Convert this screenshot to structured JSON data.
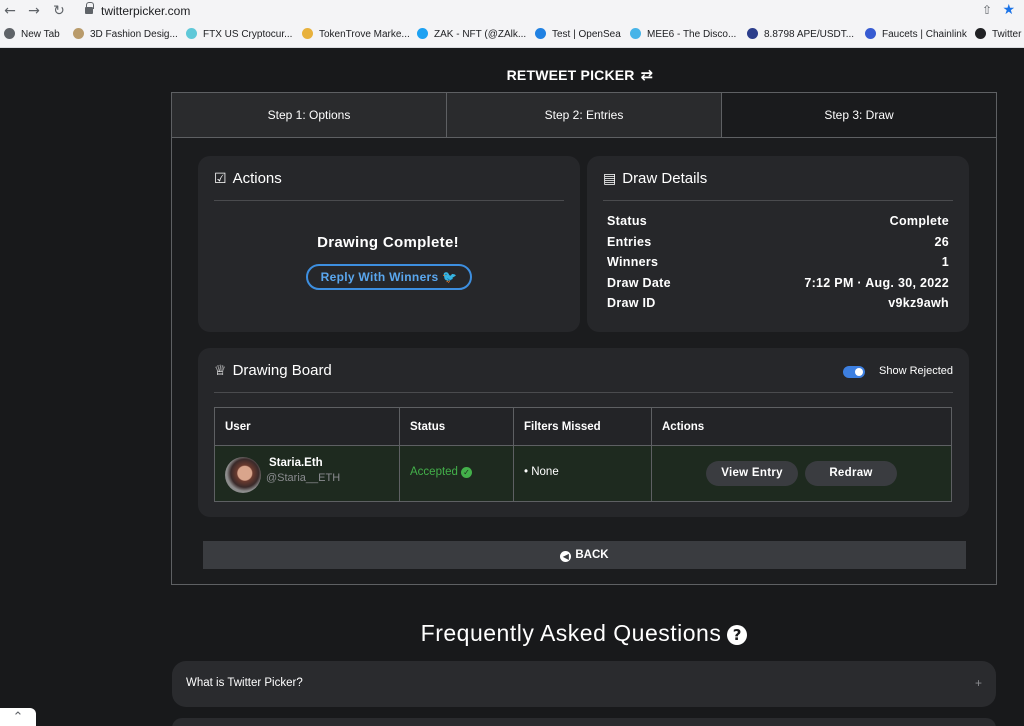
{
  "browser": {
    "url": "twitterpicker.com",
    "bookmarks": [
      {
        "label": "New Tab",
        "color": "#5f6368"
      },
      {
        "label": "3D Fashion Desig...",
        "color": "#b99b6b"
      },
      {
        "label": "FTX US Cryptocur...",
        "color": "#5fc8d8"
      },
      {
        "label": "TokenTrove Marke...",
        "color": "#e8b13c"
      },
      {
        "label": "ZAK - NFT (@ZAlk...",
        "color": "#1da1f2"
      },
      {
        "label": "Test | OpenSea",
        "color": "#2081e2"
      },
      {
        "label": "MEE6 - The Disco...",
        "color": "#47b4e8"
      },
      {
        "label": "8.8798 APE/USDT...",
        "color": "#2c3e8c"
      },
      {
        "label": "Faucets | Chainlink",
        "color": "#375bd2"
      },
      {
        "label": "Twitter",
        "color": "#202124"
      }
    ]
  },
  "page": {
    "title": "RETWEET PICKER",
    "title_icon": "retweet-icon"
  },
  "tabs": [
    "Step 1: Options",
    "Step 2: Entries",
    "Step 3: Draw"
  ],
  "actions": {
    "heading": "Actions",
    "message": "Drawing Complete!",
    "reply_button": "Reply With Winners"
  },
  "details": {
    "heading": "Draw Details",
    "rows": [
      {
        "key": "Status",
        "value": "Complete"
      },
      {
        "key": "Entries",
        "value": "26"
      },
      {
        "key": "Winners",
        "value": "1"
      },
      {
        "key": "Draw Date",
        "value": "7:12 PM · Aug. 30, 2022"
      },
      {
        "key": "Draw ID",
        "value": "v9kz9awh"
      }
    ]
  },
  "board": {
    "heading": "Drawing Board",
    "toggle_label": "Show Rejected",
    "toggle_on": true,
    "columns": [
      "User",
      "Status",
      "Filters Missed",
      "Actions"
    ],
    "row": {
      "name": "Staria.Eth",
      "handle": "@Staria__ETH",
      "status": "Accepted",
      "filters": "• None",
      "view_button": "View Entry",
      "redraw_button": "Redraw"
    }
  },
  "back_button": "BACK",
  "faq": {
    "title": "Frequently Asked Questions",
    "items": [
      "What is Twitter Picker?"
    ]
  },
  "colors": {
    "accent": "#3d8fe0",
    "success": "#43b04a",
    "background": "#18191b"
  }
}
